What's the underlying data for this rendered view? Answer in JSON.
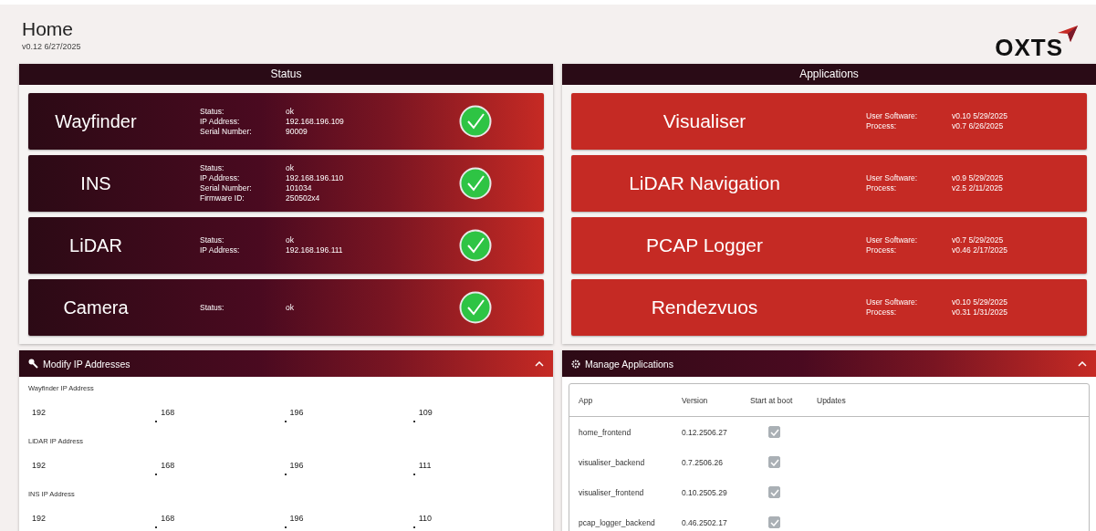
{
  "header": {
    "title": "Home",
    "version": "v0.12  6/27/2025",
    "logo": "OXTS"
  },
  "status": {
    "title": "Status",
    "devices": [
      {
        "name": "Wayfinder",
        "healthy": true,
        "fields": [
          {
            "label": "Status:",
            "value": "ok"
          },
          {
            "label": "IP Address:",
            "value": "192.168.196.109"
          },
          {
            "label": "Serial Number:",
            "value": "90009"
          }
        ]
      },
      {
        "name": "INS",
        "healthy": true,
        "fields": [
          {
            "label": "Status:",
            "value": "ok"
          },
          {
            "label": "IP Address:",
            "value": "192.168.196.110"
          },
          {
            "label": "Serial Number:",
            "value": "101034"
          },
          {
            "label": "Firmware ID:",
            "value": "250502x4"
          }
        ]
      },
      {
        "name": "LiDAR",
        "healthy": true,
        "fields": [
          {
            "label": "Status:",
            "value": "ok"
          },
          {
            "label": "IP Address:",
            "value": "192.168.196.111"
          }
        ]
      },
      {
        "name": "Camera",
        "healthy": true,
        "fields": [
          {
            "label": "Status:",
            "value": "ok"
          }
        ]
      }
    ]
  },
  "applications": {
    "title": "Applications",
    "apps": [
      {
        "name": "Visualiser",
        "fields": [
          {
            "label": "User Software:",
            "value": "v0.10  5/29/2025"
          },
          {
            "label": "Process:",
            "value": "v0.7  6/26/2025"
          }
        ]
      },
      {
        "name": "LiDAR Navigation",
        "fields": [
          {
            "label": "User Software:",
            "value": "v0.9  5/29/2025"
          },
          {
            "label": "Process:",
            "value": "v2.5  2/11/2025"
          }
        ]
      },
      {
        "name": "PCAP Logger",
        "fields": [
          {
            "label": "User Software:",
            "value": "v0.7  5/29/2025"
          },
          {
            "label": "Process:",
            "value": "v0.46  2/17/2025"
          }
        ]
      },
      {
        "name": "Rendezvuos",
        "fields": [
          {
            "label": "User Software:",
            "value": "v0.10  5/29/2025"
          },
          {
            "label": "Process:",
            "value": "v0.31  1/31/2025"
          }
        ]
      }
    ]
  },
  "modify_ip": {
    "title": "Modify IP Addresses",
    "expanded": true,
    "addresses": [
      {
        "label": "Wayfinder IP Address",
        "octets": [
          "192",
          "168",
          "196",
          "109"
        ]
      },
      {
        "label": "LiDAR IP Address",
        "octets": [
          "192",
          "168",
          "196",
          "111"
        ]
      },
      {
        "label": "INS IP Address",
        "octets": [
          "192",
          "168",
          "196",
          "110"
        ]
      }
    ]
  },
  "manage_apps": {
    "title": "Manage Applications",
    "expanded": true,
    "columns": [
      "App",
      "Version",
      "Start at boot",
      "Updates"
    ],
    "rows": [
      {
        "app": "home_frontend",
        "version": "0.12.2506.27",
        "start_at_boot": true
      },
      {
        "app": "visualiser_backend",
        "version": "0.7.2506.26",
        "start_at_boot": true
      },
      {
        "app": "visualiser_frontend",
        "version": "0.10.2505.29",
        "start_at_boot": true
      },
      {
        "app": "pcap_logger_backend",
        "version": "0.46.2502.17",
        "start_at_boot": true
      }
    ]
  }
}
